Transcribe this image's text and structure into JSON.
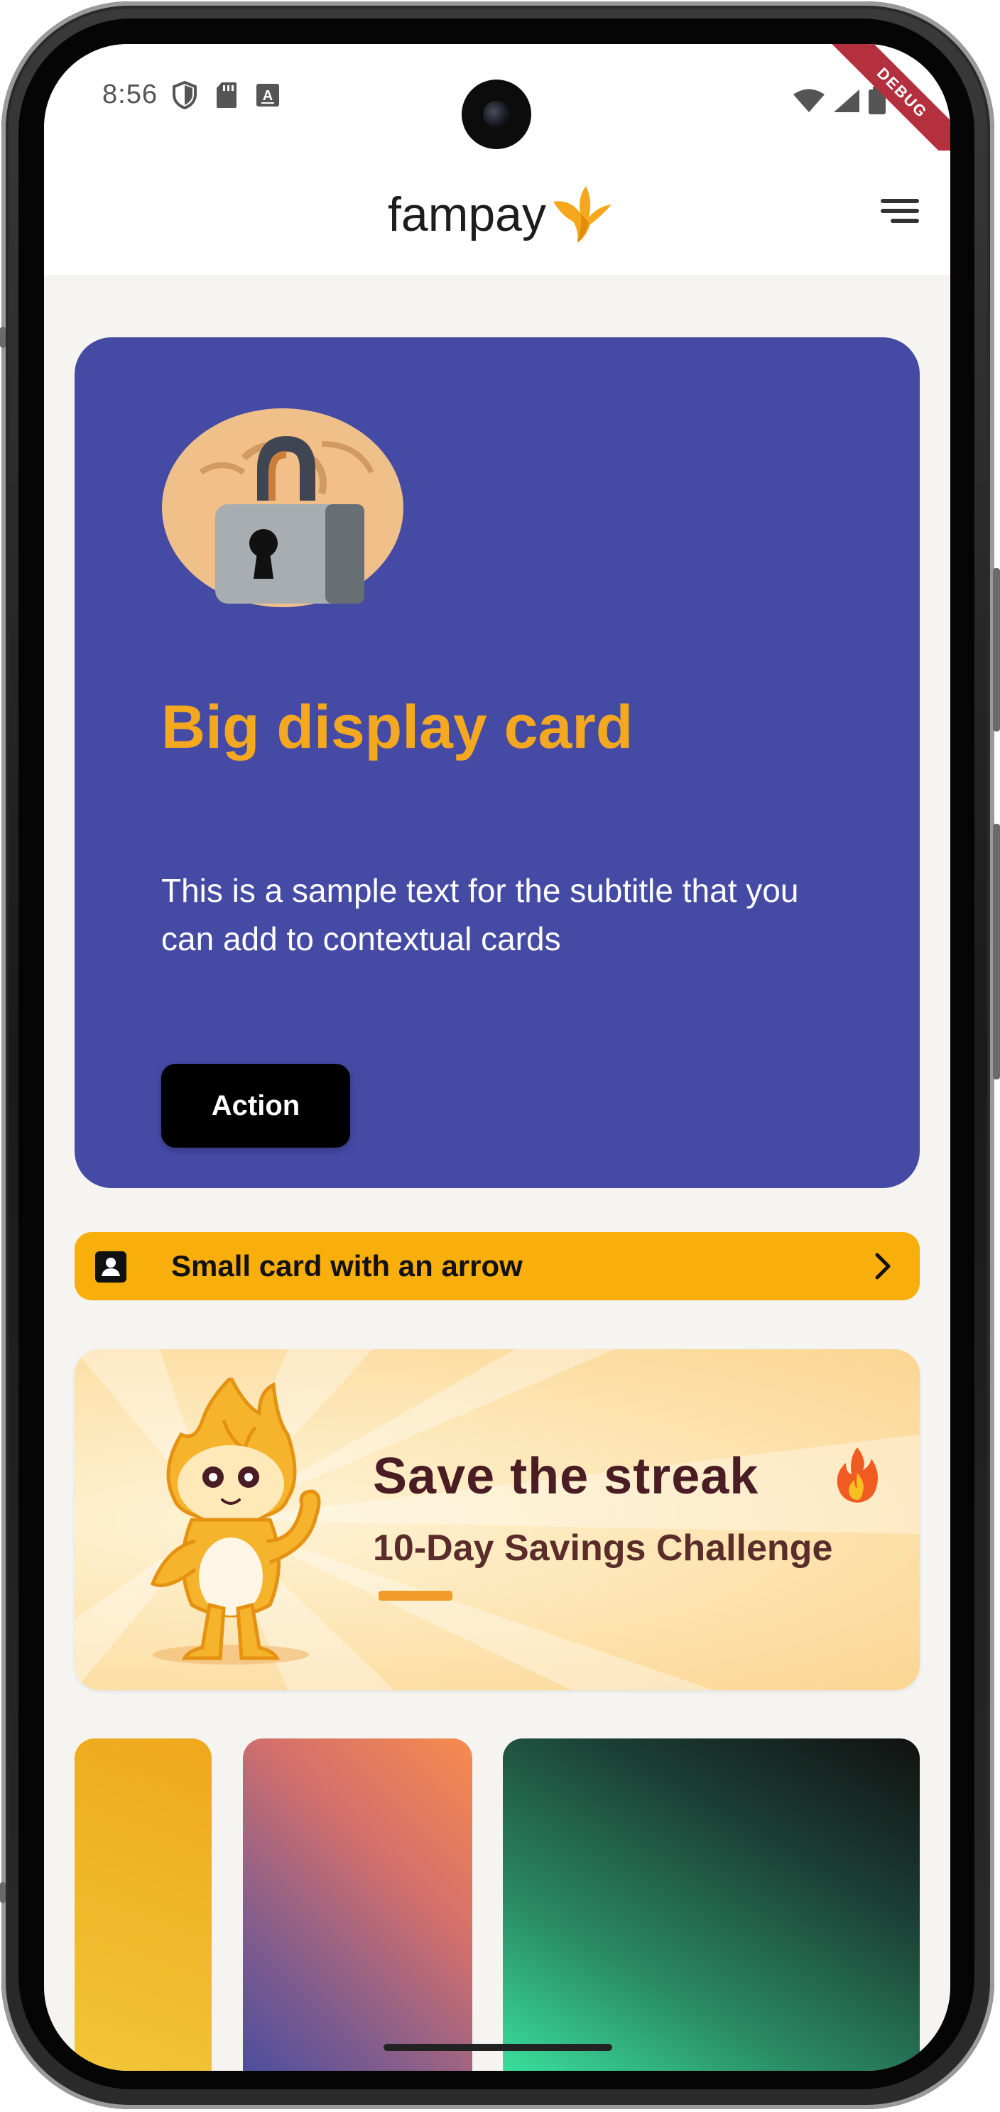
{
  "status_bar": {
    "time": "8:56",
    "debug_ribbon": "DEBUG"
  },
  "app_bar": {
    "logo_text": "fampay",
    "menu_icon": "menu-icon"
  },
  "big_card": {
    "title": "Big display card",
    "subtitle": "This is a sample text for the subtitle that you can add to contextual cards",
    "action_label": "Action",
    "background_color": "#454aa5",
    "title_color": "#f4a81f",
    "illustration": "locked-hand-icon"
  },
  "small_card": {
    "label": "Small card with an arrow",
    "icon": "user-badge-icon",
    "trailing_icon": "chevron-right-icon",
    "background_color": "#f8ae0b"
  },
  "banner": {
    "headline": "Save the streak",
    "subline": "10-Day Savings Challenge",
    "icons": [
      "flame-mascot-icon",
      "fire-emoji-icon"
    ]
  },
  "gradient_tiles": [
    {
      "colors": [
        "#efa81d",
        "#f2c83a"
      ]
    },
    {
      "colors": [
        "#f78b4e",
        "#3f4aa3"
      ]
    },
    {
      "colors": [
        "#111111",
        "#3df0a8"
      ]
    }
  ]
}
